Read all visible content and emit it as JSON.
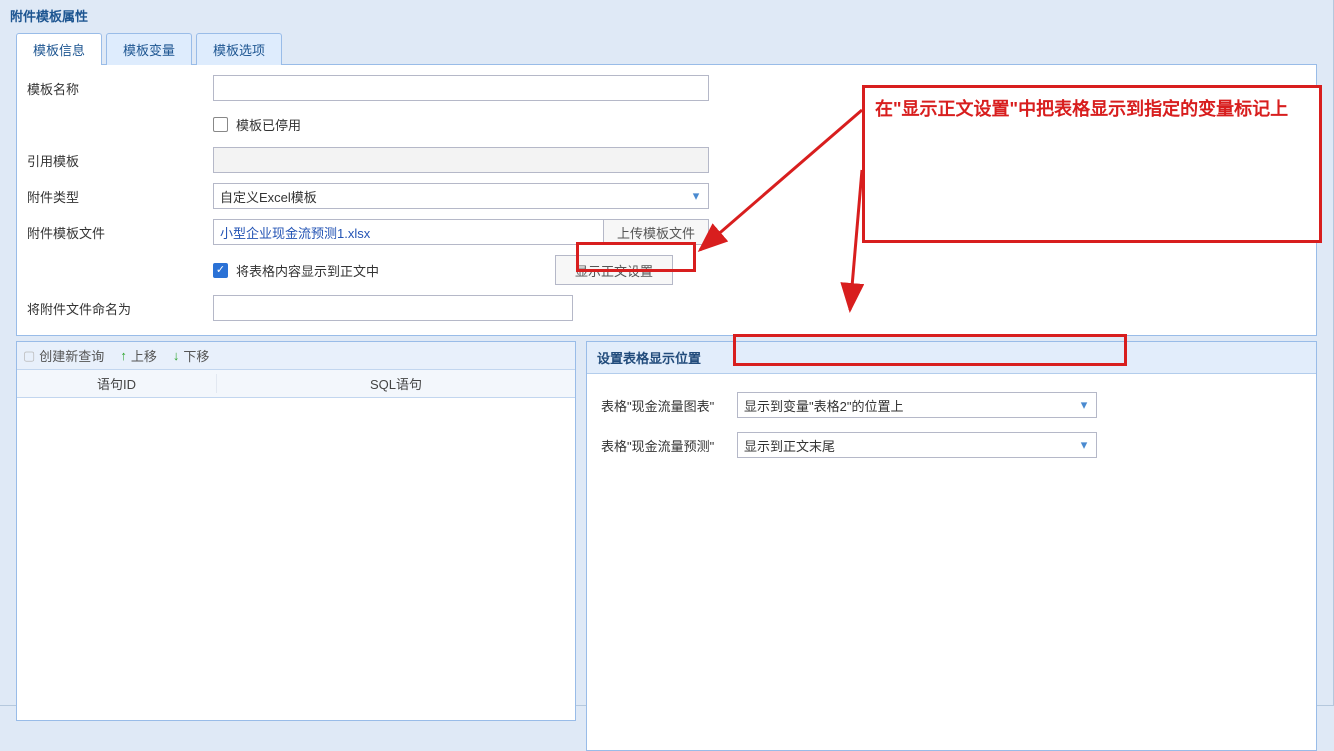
{
  "panel": {
    "title": "附件模板属性"
  },
  "tabs": {
    "items": [
      {
        "label": "模板信息"
      },
      {
        "label": "模板变量"
      },
      {
        "label": "模板选项"
      }
    ]
  },
  "form": {
    "name_label": "模板名称",
    "name_value": "",
    "disabled_label": "模板已停用",
    "ref_label": "引用模板",
    "ref_value": "",
    "type_label": "附件类型",
    "type_value": "自定义Excel模板",
    "file_label": "附件模板文件",
    "file_link": "小型企业现金流预测1.xlsx",
    "upload_btn": "上传模板文件",
    "show_in_body_label": "将表格内容显示到正文中",
    "display_settings_btn": "显示正文设置",
    "rename_label": "将附件文件命名为",
    "rename_value": ""
  },
  "toolbar": {
    "new_query": "创建新查询",
    "move_up": "上移",
    "move_down": "下移"
  },
  "grid": {
    "col1": "语句ID",
    "col2": "SQL语句"
  },
  "modal": {
    "title": "设置表格显示位置",
    "row1_label": "表格\"现金流量图表\"",
    "row1_value": "显示到变量\"表格2\"的位置上",
    "row2_label": "表格\"现金流量预测\"",
    "row2_value": "显示到正文末尾"
  },
  "annotation": {
    "text": "在\"显示正文设置\"中把表格显示到指定的变量标记上"
  },
  "icons": {
    "dropdown": "▾",
    "up": "↑",
    "down": "↓",
    "check": "✓",
    "doc": "▢"
  }
}
